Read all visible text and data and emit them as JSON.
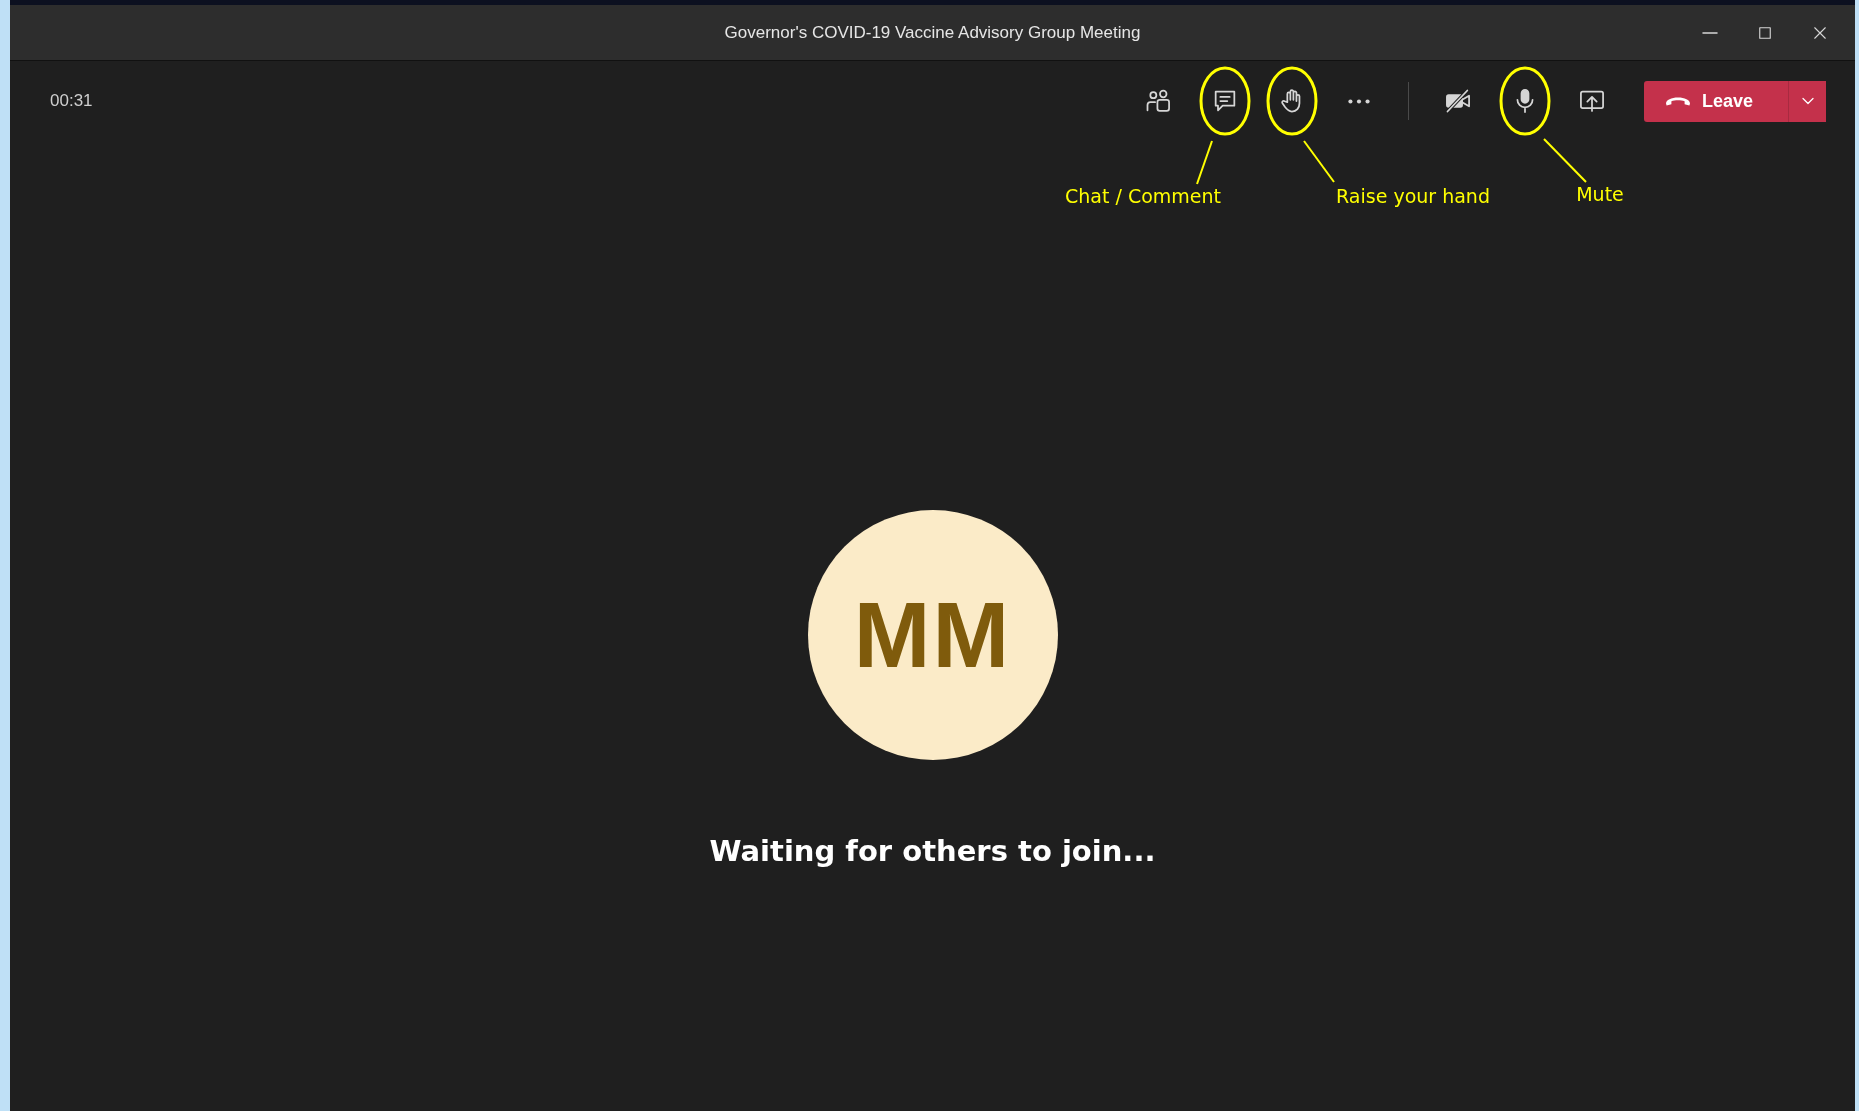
{
  "window": {
    "title": "Governor's COVID-19 Vaccine Advisory Group Meeting"
  },
  "toolbar": {
    "timer": "00:31",
    "buttons": [
      {
        "kind": "people"
      },
      {
        "kind": "chat"
      },
      {
        "kind": "hand"
      },
      {
        "kind": "more"
      },
      {
        "kind": "divider"
      },
      {
        "kind": "camera",
        "on": false
      },
      {
        "kind": "mic",
        "on": true
      },
      {
        "kind": "share"
      }
    ],
    "leave": {
      "label": "Leave"
    }
  },
  "stage": {
    "initials": "MM",
    "status": "Waiting for others to join..."
  },
  "annotations": [
    {
      "label": "Chat / Comment"
    },
    {
      "label": "Raise your hand"
    },
    {
      "label": "Mute"
    }
  ]
}
